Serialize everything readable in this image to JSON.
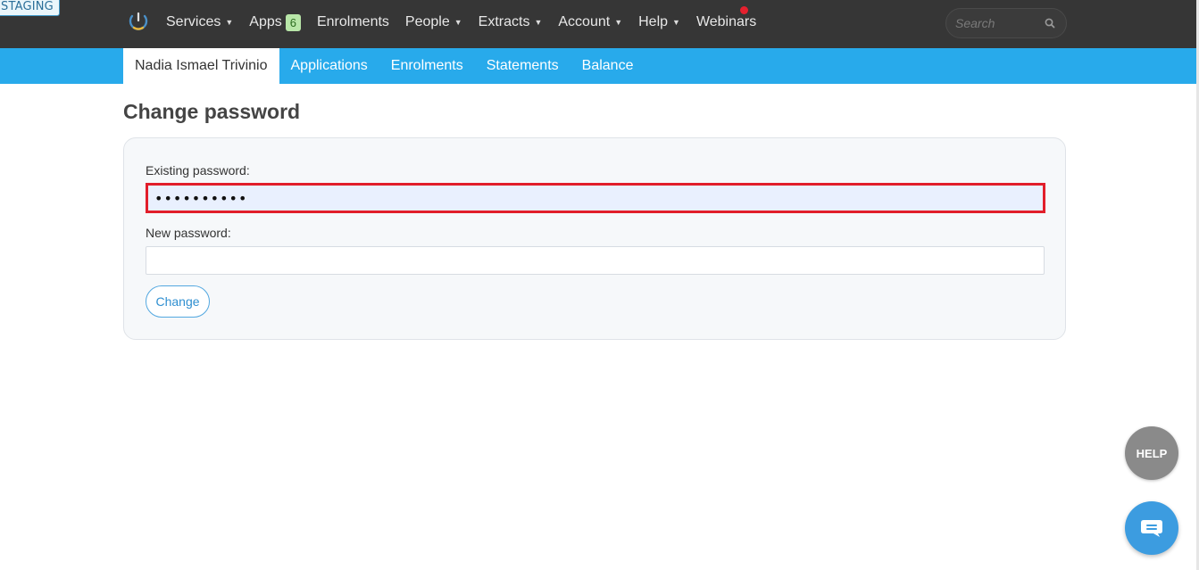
{
  "environment_badge": "STAGING",
  "topbar": {
    "logo_icon": "power-ring-logo-icon",
    "nav": [
      {
        "label": "Services",
        "dropdown": true
      },
      {
        "label": "Apps",
        "badge": "6",
        "dropdown": false
      },
      {
        "label": "Enrolments",
        "dropdown": false
      },
      {
        "label": "People",
        "dropdown": true
      },
      {
        "label": "Extracts",
        "dropdown": true
      },
      {
        "label": "Account",
        "dropdown": true
      },
      {
        "label": "Help",
        "dropdown": true
      },
      {
        "label": "Webinars",
        "dropdown": false
      }
    ],
    "caret_glyph": "▼",
    "search": {
      "placeholder": "Search",
      "value": ""
    }
  },
  "subnav": {
    "tabs": [
      {
        "label": "Nadia Ismael Trivinio",
        "active": true
      },
      {
        "label": "Applications",
        "active": false
      },
      {
        "label": "Enrolments",
        "active": false
      },
      {
        "label": "Statements",
        "active": false
      },
      {
        "label": "Balance",
        "active": false
      }
    ]
  },
  "page": {
    "title": "Change password",
    "form": {
      "existing_label": "Existing password:",
      "existing_value": "••••••••••",
      "new_label": "New password:",
      "new_value": "",
      "submit_label": "Change"
    }
  },
  "floating": {
    "help_label": "HELP",
    "chat_icon": "chat-bubble-icon"
  },
  "colors": {
    "topbar_bg": "#363636",
    "subnav_bg": "#28aaeb",
    "highlight_border": "#e11e2a",
    "notification_dot": "#e5202e",
    "apps_badge_bg": "#b8e6a8",
    "chat_button": "#3c9ce0",
    "help_button": "#8a8a8a"
  }
}
